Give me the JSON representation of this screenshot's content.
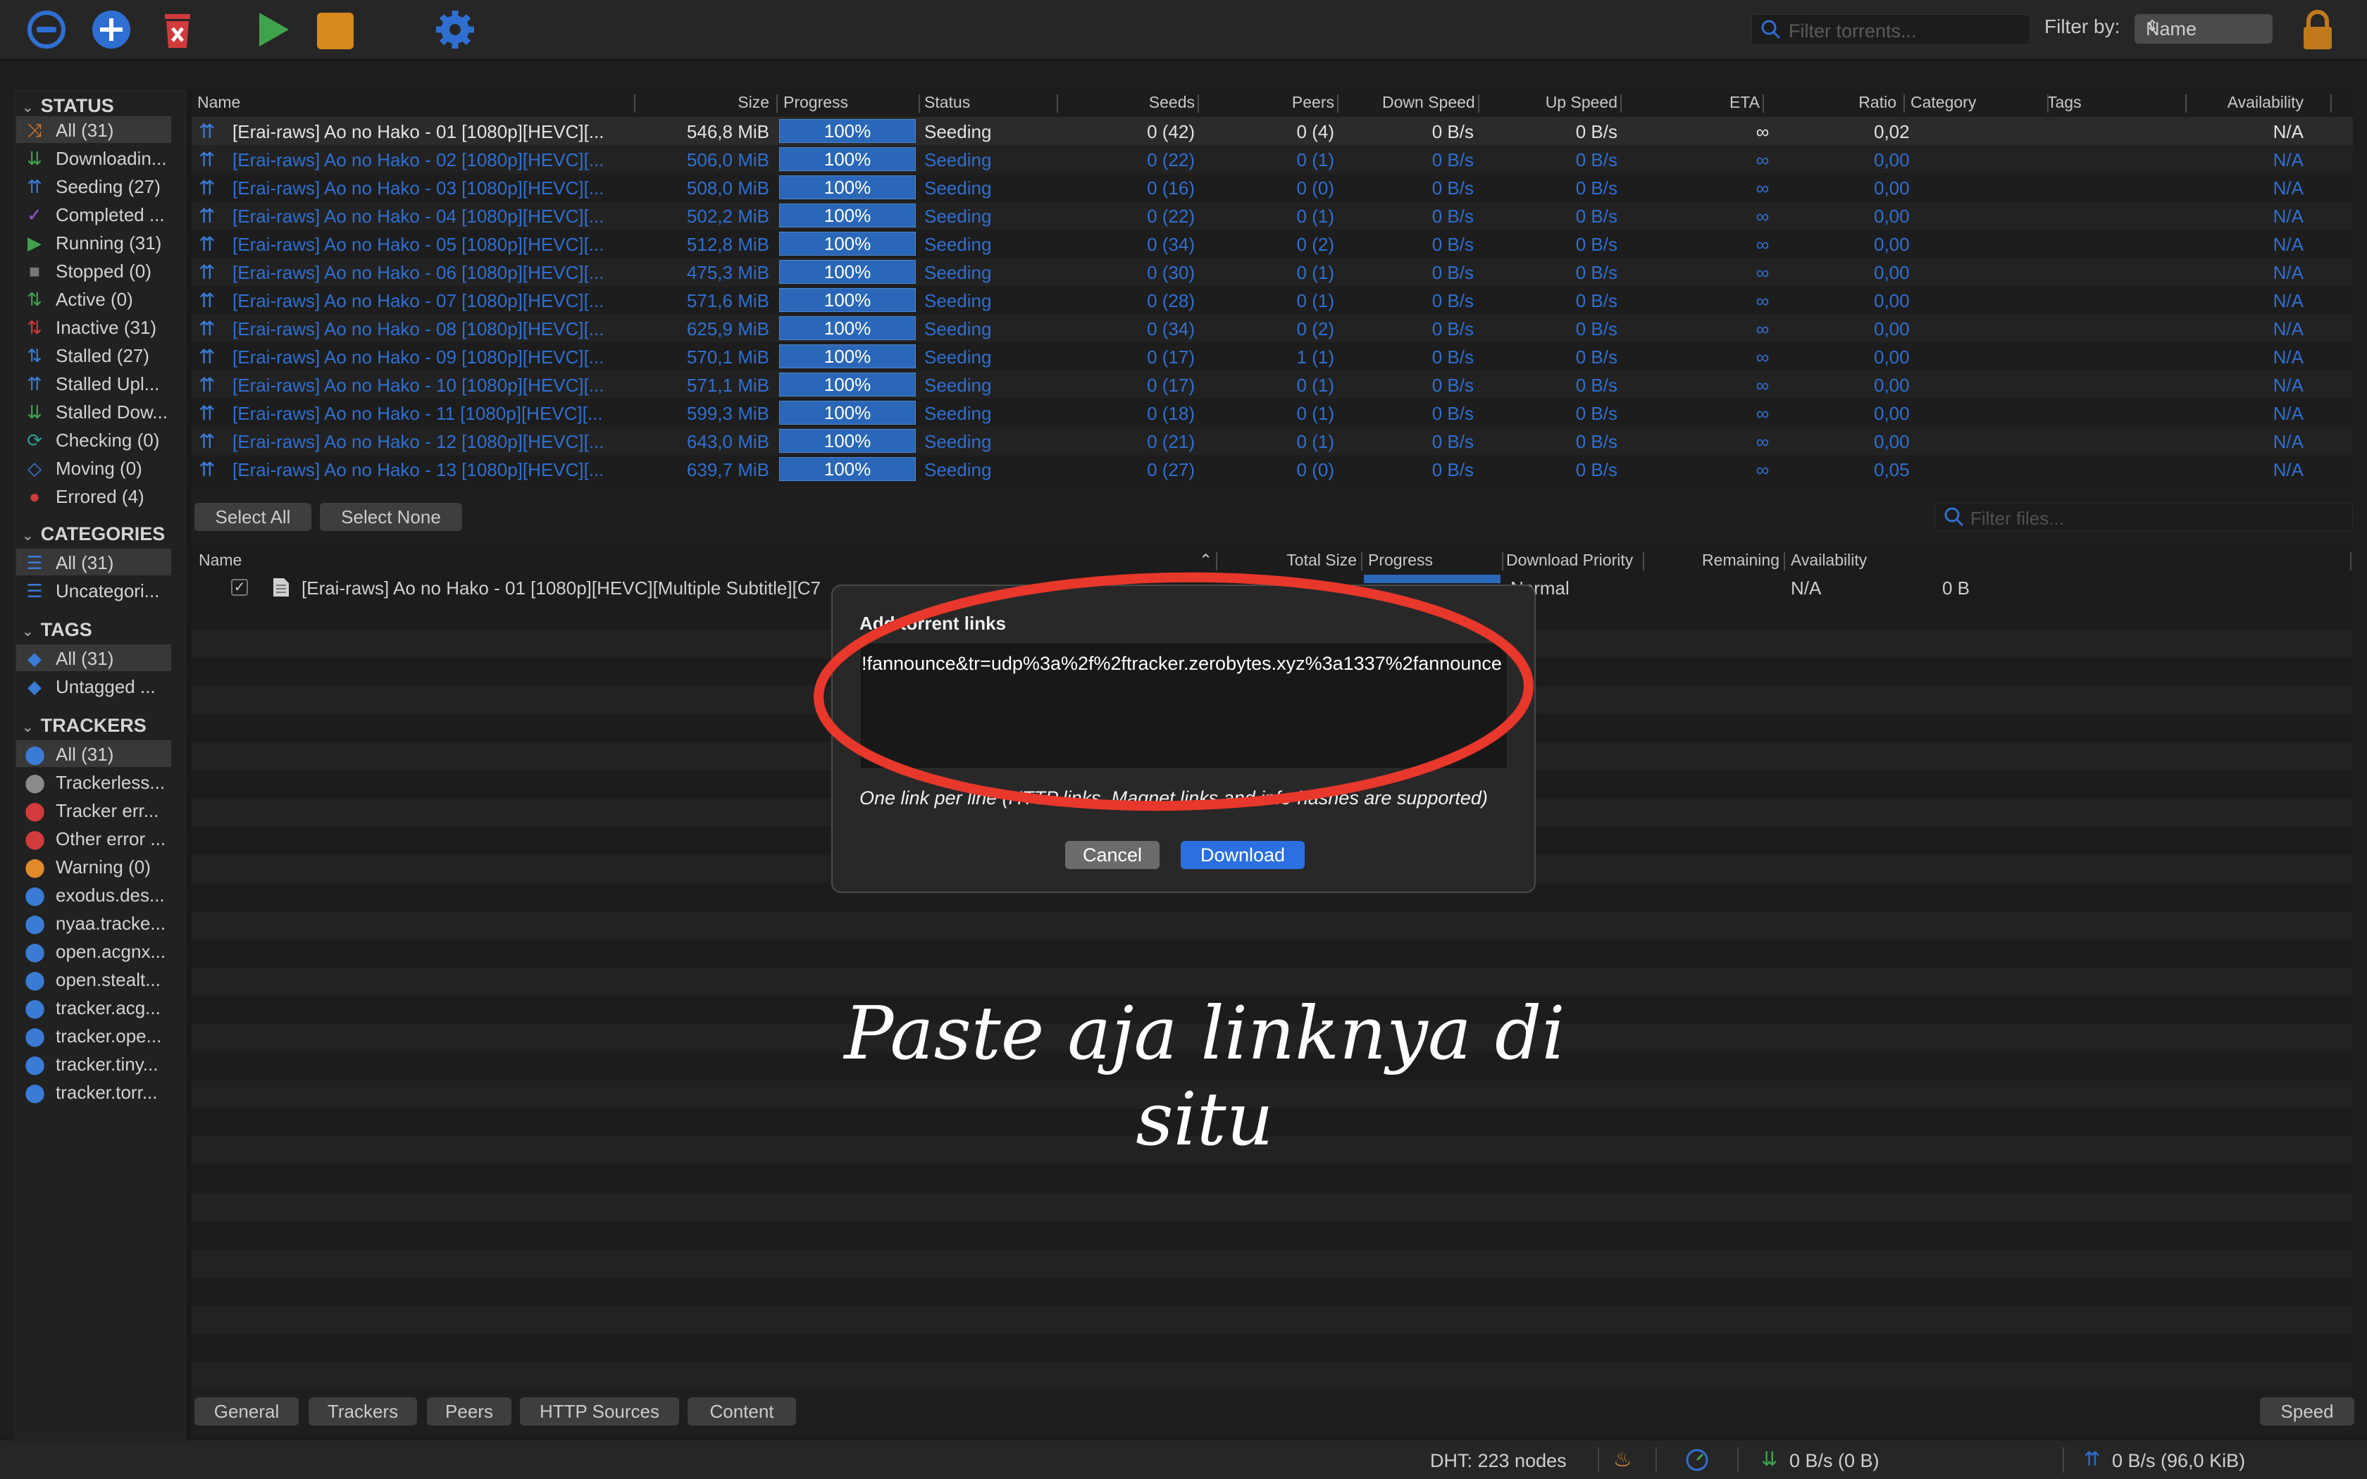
{
  "toolbar": {
    "filter_placeholder": "Filter torrents...",
    "filter_by_label": "Filter by:",
    "filter_by_value": "Name"
  },
  "sidebar": {
    "status_header": "STATUS",
    "status": [
      {
        "label": "All (31)",
        "icon": "all-icon",
        "color": "#e07c2c"
      },
      {
        "label": "Downloadin...",
        "icon": "downloading-icon",
        "color": "#3fa34d"
      },
      {
        "label": "Seeding (27)",
        "icon": "seeding-icon",
        "color": "#3a7bd5"
      },
      {
        "label": "Completed ...",
        "icon": "check-icon",
        "color": "#8e5bd8"
      },
      {
        "label": "Running (31)",
        "icon": "play-icon",
        "color": "#3fa34d"
      },
      {
        "label": "Stopped (0)",
        "icon": "stop-icon",
        "color": "#777777"
      },
      {
        "label": "Active (0)",
        "icon": "active-icon",
        "color": "#3fa34d"
      },
      {
        "label": "Inactive (31)",
        "icon": "inactive-icon",
        "color": "#d23b3b"
      },
      {
        "label": "Stalled (27)",
        "icon": "stalled-icon",
        "color": "#3a7bd5"
      },
      {
        "label": "Stalled Upl...",
        "icon": "stalled-upload-icon",
        "color": "#3a7bd5"
      },
      {
        "label": "Stalled Dow...",
        "icon": "stalled-download-icon",
        "color": "#3fa34d"
      },
      {
        "label": "Checking (0)",
        "icon": "checking-icon",
        "color": "#2f9e8f"
      },
      {
        "label": "Moving (0)",
        "icon": "moving-icon",
        "color": "#3a7bd5"
      },
      {
        "label": "Errored (4)",
        "icon": "error-icon",
        "color": "#d23b3b"
      }
    ],
    "categories_header": "CATEGORIES",
    "categories": [
      {
        "label": "All (31)"
      },
      {
        "label": "Uncategori..."
      }
    ],
    "tags_header": "TAGS",
    "tags": [
      {
        "label": "All (31)"
      },
      {
        "label": "Untagged ..."
      }
    ],
    "trackers_header": "TRACKERS",
    "trackers": [
      {
        "label": "All (31)",
        "color": "#3a7bd5"
      },
      {
        "label": "Trackerless...",
        "color": "#8a8a8a"
      },
      {
        "label": "Tracker err...",
        "color": "#d23b3b"
      },
      {
        "label": "Other error ...",
        "color": "#d23b3b"
      },
      {
        "label": "Warning (0)",
        "color": "#e08a2c"
      },
      {
        "label": "exodus.des...",
        "color": "#3a7bd5"
      },
      {
        "label": "nyaa.tracke...",
        "color": "#3a7bd5"
      },
      {
        "label": "open.acgnx...",
        "color": "#3a7bd5"
      },
      {
        "label": "open.stealt...",
        "color": "#3a7bd5"
      },
      {
        "label": "tracker.acg...",
        "color": "#3a7bd5"
      },
      {
        "label": "tracker.ope...",
        "color": "#3a7bd5"
      },
      {
        "label": "tracker.tiny...",
        "color": "#3a7bd5"
      },
      {
        "label": "tracker.torr...",
        "color": "#3a7bd5"
      }
    ]
  },
  "torrents": {
    "columns": [
      "Name",
      "Size",
      "Progress",
      "Status",
      "Seeds",
      "Peers",
      "Down Speed",
      "Up Speed",
      "ETA",
      "Ratio",
      "Category",
      "Tags",
      "Availability"
    ],
    "rows": [
      {
        "name": "[Erai-raws] Ao no Hako - 01 [1080p][HEVC][...",
        "size": "546,8 MiB",
        "progress": "100%",
        "status": "Seeding",
        "seeds": "0 (42)",
        "peers": "0 (4)",
        "down": "0 B/s",
        "up": "0 B/s",
        "eta": "∞",
        "ratio": "0,02",
        "availability": "N/A"
      },
      {
        "name": "[Erai-raws] Ao no Hako - 02 [1080p][HEVC][...",
        "size": "506,0 MiB",
        "progress": "100%",
        "status": "Seeding",
        "seeds": "0 (22)",
        "peers": "0 (1)",
        "down": "0 B/s",
        "up": "0 B/s",
        "eta": "∞",
        "ratio": "0,00",
        "availability": "N/A"
      },
      {
        "name": "[Erai-raws] Ao no Hako - 03 [1080p][HEVC][...",
        "size": "508,0 MiB",
        "progress": "100%",
        "status": "Seeding",
        "seeds": "0 (16)",
        "peers": "0 (0)",
        "down": "0 B/s",
        "up": "0 B/s",
        "eta": "∞",
        "ratio": "0,00",
        "availability": "N/A"
      },
      {
        "name": "[Erai-raws] Ao no Hako - 04 [1080p][HEVC][...",
        "size": "502,2 MiB",
        "progress": "100%",
        "status": "Seeding",
        "seeds": "0 (22)",
        "peers": "0 (1)",
        "down": "0 B/s",
        "up": "0 B/s",
        "eta": "∞",
        "ratio": "0,00",
        "availability": "N/A"
      },
      {
        "name": "[Erai-raws] Ao no Hako - 05 [1080p][HEVC][...",
        "size": "512,8 MiB",
        "progress": "100%",
        "status": "Seeding",
        "seeds": "0 (34)",
        "peers": "0 (2)",
        "down": "0 B/s",
        "up": "0 B/s",
        "eta": "∞",
        "ratio": "0,00",
        "availability": "N/A"
      },
      {
        "name": "[Erai-raws] Ao no Hako - 06 [1080p][HEVC][...",
        "size": "475,3 MiB",
        "progress": "100%",
        "status": "Seeding",
        "seeds": "0 (30)",
        "peers": "0 (1)",
        "down": "0 B/s",
        "up": "0 B/s",
        "eta": "∞",
        "ratio": "0,00",
        "availability": "N/A"
      },
      {
        "name": "[Erai-raws] Ao no Hako - 07 [1080p][HEVC][...",
        "size": "571,6 MiB",
        "progress": "100%",
        "status": "Seeding",
        "seeds": "0 (28)",
        "peers": "0 (1)",
        "down": "0 B/s",
        "up": "0 B/s",
        "eta": "∞",
        "ratio": "0,00",
        "availability": "N/A"
      },
      {
        "name": "[Erai-raws] Ao no Hako - 08 [1080p][HEVC][...",
        "size": "625,9 MiB",
        "progress": "100%",
        "status": "Seeding",
        "seeds": "0 (34)",
        "peers": "0 (2)",
        "down": "0 B/s",
        "up": "0 B/s",
        "eta": "∞",
        "ratio": "0,00",
        "availability": "N/A"
      },
      {
        "name": "[Erai-raws] Ao no Hako - 09 [1080p][HEVC][...",
        "size": "570,1 MiB",
        "progress": "100%",
        "status": "Seeding",
        "seeds": "0 (17)",
        "peers": "1 (1)",
        "down": "0 B/s",
        "up": "0 B/s",
        "eta": "∞",
        "ratio": "0,00",
        "availability": "N/A"
      },
      {
        "name": "[Erai-raws] Ao no Hako - 10 [1080p][HEVC][...",
        "size": "571,1 MiB",
        "progress": "100%",
        "status": "Seeding",
        "seeds": "0 (17)",
        "peers": "0 (1)",
        "down": "0 B/s",
        "up": "0 B/s",
        "eta": "∞",
        "ratio": "0,00",
        "availability": "N/A"
      },
      {
        "name": "[Erai-raws] Ao no Hako - 11 [1080p][HEVC][...",
        "size": "599,3 MiB",
        "progress": "100%",
        "status": "Seeding",
        "seeds": "0 (18)",
        "peers": "0 (1)",
        "down": "0 B/s",
        "up": "0 B/s",
        "eta": "∞",
        "ratio": "0,00",
        "availability": "N/A"
      },
      {
        "name": "[Erai-raws] Ao no Hako - 12 [1080p][HEVC][...",
        "size": "643,0 MiB",
        "progress": "100%",
        "status": "Seeding",
        "seeds": "0 (21)",
        "peers": "0 (1)",
        "down": "0 B/s",
        "up": "0 B/s",
        "eta": "∞",
        "ratio": "0,00",
        "availability": "N/A"
      },
      {
        "name": "[Erai-raws] Ao no Hako - 13 [1080p][HEVC][...",
        "size": "639,7 MiB",
        "progress": "100%",
        "status": "Seeding",
        "seeds": "0 (27)",
        "peers": "0 (0)",
        "down": "0 B/s",
        "up": "0 B/s",
        "eta": "∞",
        "ratio": "0,05",
        "availability": "N/A"
      }
    ]
  },
  "selection": {
    "select_all": "Select All",
    "select_none": "Select None",
    "filter_files_placeholder": "Filter files..."
  },
  "files": {
    "columns": [
      "Name",
      "Total Size",
      "Progress",
      "Download Priority",
      "Remaining",
      "Availability"
    ],
    "row": {
      "name": "[Erai-raws] Ao no Hako - 01 [1080p][HEVC][Multiple Subtitle][C7",
      "priority": "Normal",
      "remaining": "0 B",
      "availability": "N/A"
    }
  },
  "dialog": {
    "title": "Add torrent links",
    "text": "!fannounce&tr=udp%3a%2f%2ftracker.zerobytes.xyz%3a1337%2fannounce",
    "hint": "One link per line (HTTP links, Magnet links and info-hashes are supported)",
    "cancel": "Cancel",
    "download": "Download"
  },
  "annotation": {
    "caption": "Paste aja linknya di situ",
    "circle_color": "#e8372b"
  },
  "tabs": [
    "General",
    "Trackers",
    "Peers",
    "HTTP Sources",
    "Content"
  ],
  "speed_button": "Speed",
  "statusbar": {
    "dht": "DHT: 223 nodes",
    "download": "0 B/s (0 B)",
    "upload": "0 B/s (96,0 KiB)"
  }
}
